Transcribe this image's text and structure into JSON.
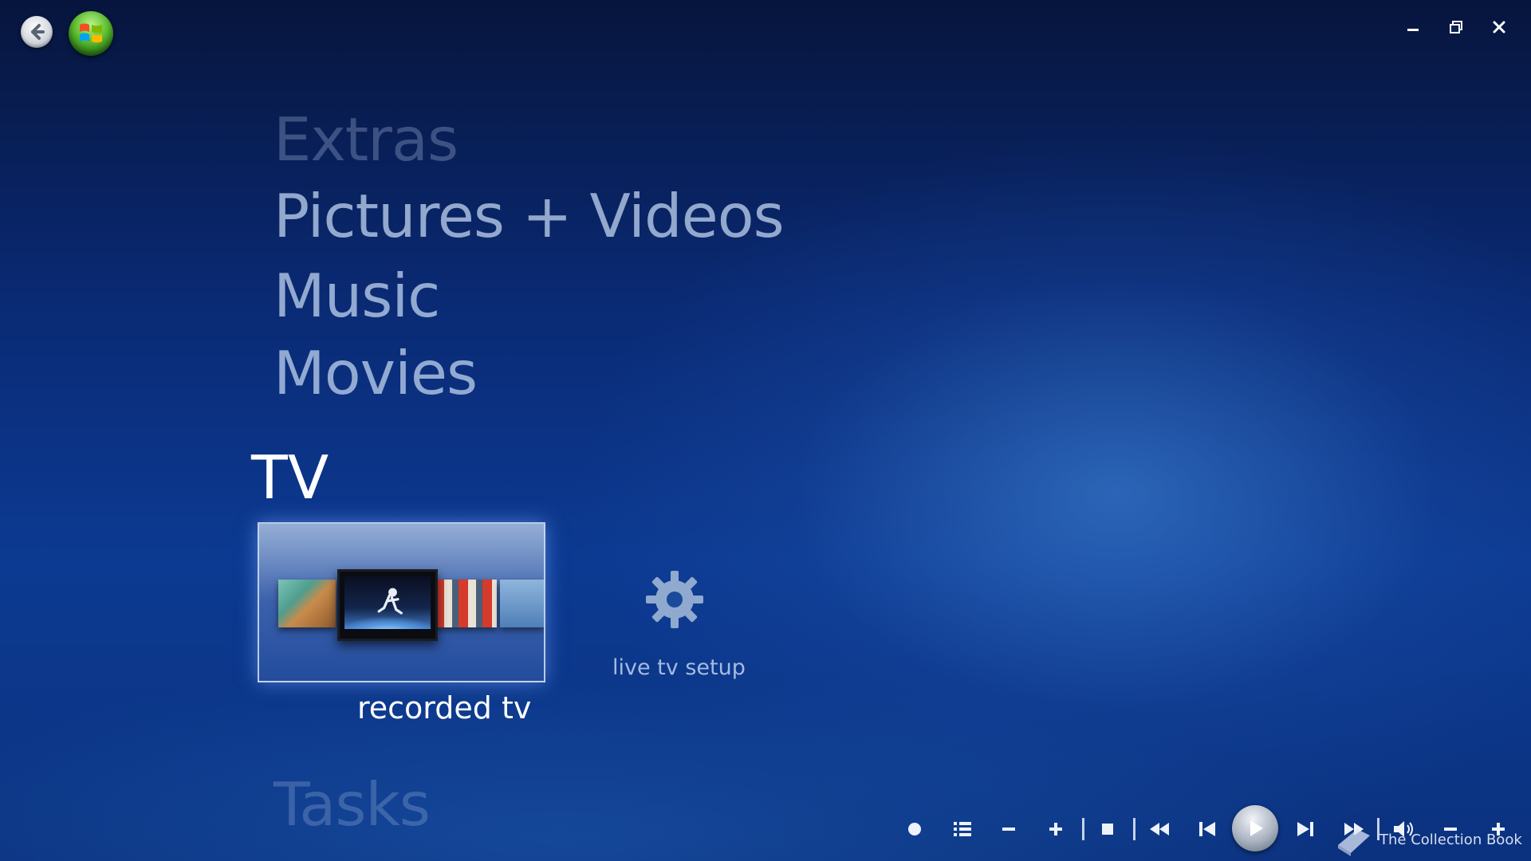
{
  "window_controls": {
    "minimize_label": "—",
    "restore_label": "❐",
    "close_label": "✕"
  },
  "menu": {
    "extras": "Extras",
    "pictures_videos": "Pictures + Videos",
    "music": "Music",
    "movies": "Movies",
    "tv": "TV",
    "tasks": "Tasks"
  },
  "tv": {
    "recorded_label": "recorded tv",
    "live_setup_label": "live tv setup"
  },
  "watermark": {
    "text": "The Collection Book"
  },
  "colors": {
    "background_dark": "#07153d",
    "background_mid": "#0c3a92",
    "menu_text": "#b9cdeb",
    "selected_text": "#ffffff",
    "start_orb": "#5cbc2e"
  },
  "icons": {
    "back": "back-arrow-icon",
    "start": "windows-start-orb-icon",
    "gear": "gear-icon",
    "record": "record-icon",
    "guide": "guide-list-icon",
    "channel_down": "minus-icon",
    "channel_up": "plus-icon",
    "stop": "stop-icon",
    "rewind": "rewind-icon",
    "skip_back": "skip-back-icon",
    "play": "play-icon",
    "skip_forward": "skip-forward-icon",
    "fast_forward": "fast-forward-icon",
    "volume": "volume-icon",
    "volume_down": "volume-down-icon",
    "volume_up": "volume-up-icon"
  }
}
